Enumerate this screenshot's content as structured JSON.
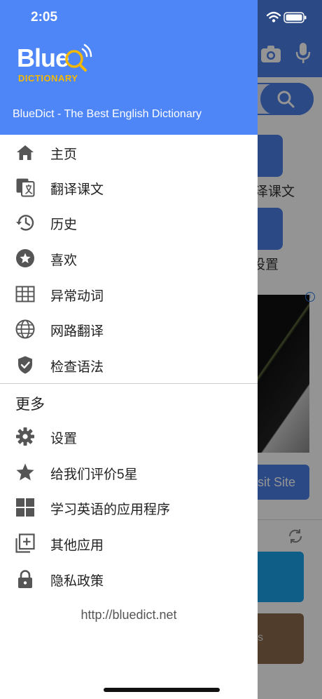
{
  "status_bar": {
    "time": "2:05"
  },
  "drawer": {
    "logo": {
      "word": "Blue",
      "sub": "DICTIONARY"
    },
    "tagline": "BlueDict - The Best English Dictionary",
    "menu_items": [
      {
        "label": "主页",
        "icon": "home-icon"
      },
      {
        "label": "翻译课文",
        "icon": "translate-icon"
      },
      {
        "label": "历史",
        "icon": "history-icon"
      },
      {
        "label": "喜欢",
        "icon": "star-circle-icon"
      },
      {
        "label": "异常动词",
        "icon": "table-icon"
      },
      {
        "label": "网路翻译",
        "icon": "globe-icon"
      },
      {
        "label": "检查语法",
        "icon": "shield-check-icon"
      }
    ],
    "section_title": "更多",
    "more_items": [
      {
        "label": "设置",
        "icon": "gear-icon"
      },
      {
        "label": "给我们评价5星",
        "icon": "star-icon"
      },
      {
        "label": "学习英语的应用程序",
        "icon": "apps-grid-icon"
      },
      {
        "label": "其他应用",
        "icon": "add-box-icon"
      },
      {
        "label": "隐私政策",
        "icon": "lock-icon"
      }
    ],
    "website": "http://bluedict.net"
  },
  "background": {
    "tile_label_1": "泽课文",
    "tile_label_2": "设置",
    "visit_button": "sit Site",
    "card_text": "s"
  },
  "colors": {
    "header_blue": "#4f86f7",
    "logo_orange": "#f5b800",
    "icon_gray": "#555555"
  }
}
